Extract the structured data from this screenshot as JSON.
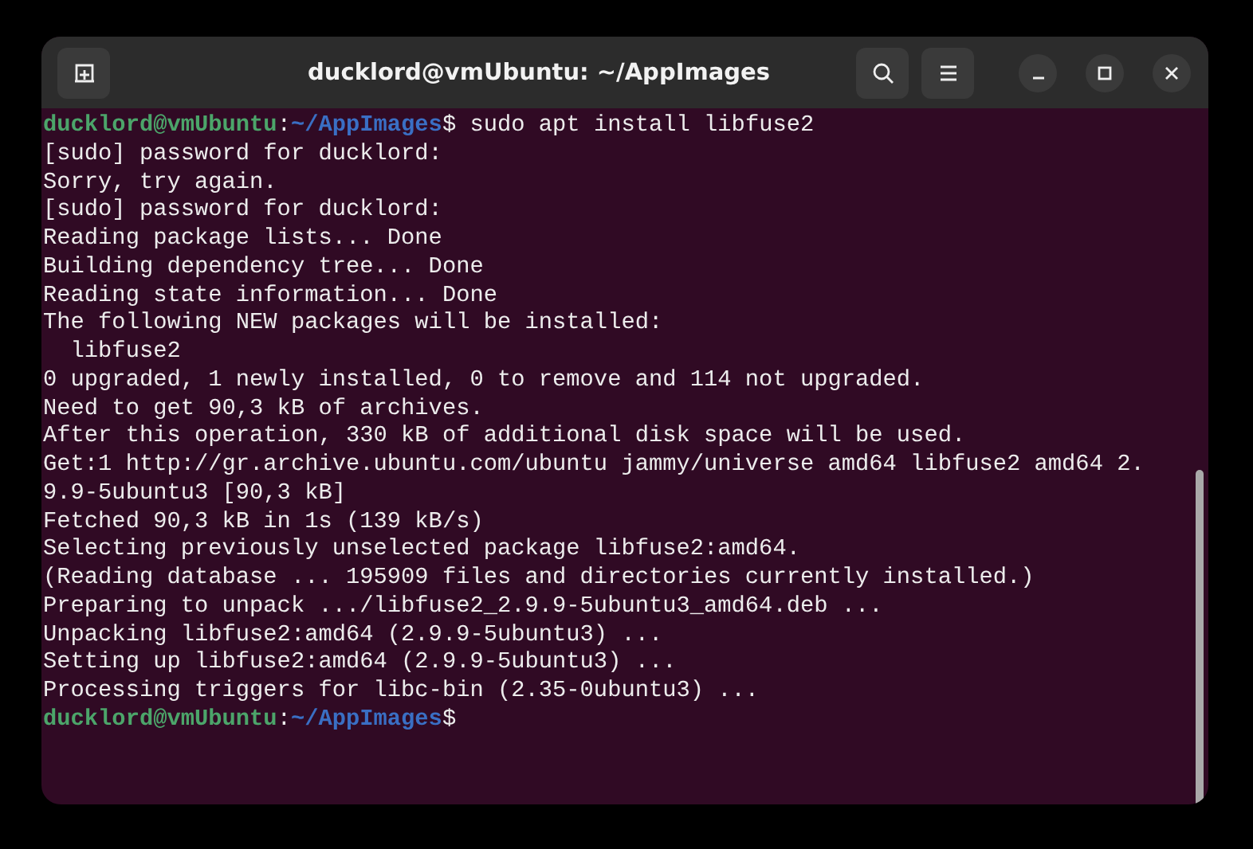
{
  "window": {
    "title": "ducklord@vmUbuntu: ~/AppImages"
  },
  "lines": [
    {
      "kind": "prompt",
      "user": "ducklord@vmUbuntu",
      "separator": ":",
      "path": "~/AppImages",
      "symbol": "$",
      "command": " sudo apt install libfuse2"
    },
    {
      "kind": "output",
      "text": "[sudo] password for ducklord:"
    },
    {
      "kind": "output",
      "text": "Sorry, try again."
    },
    {
      "kind": "output",
      "text": "[sudo] password for ducklord:"
    },
    {
      "kind": "output",
      "text": "Reading package lists... Done"
    },
    {
      "kind": "output",
      "text": "Building dependency tree... Done"
    },
    {
      "kind": "output",
      "text": "Reading state information... Done"
    },
    {
      "kind": "output",
      "text": "The following NEW packages will be installed:"
    },
    {
      "kind": "output",
      "text": "  libfuse2"
    },
    {
      "kind": "output",
      "text": "0 upgraded, 1 newly installed, 0 to remove and 114 not upgraded."
    },
    {
      "kind": "output",
      "text": "Need to get 90,3 kB of archives."
    },
    {
      "kind": "output",
      "text": "After this operation, 330 kB of additional disk space will be used."
    },
    {
      "kind": "output",
      "text": "Get:1 http://gr.archive.ubuntu.com/ubuntu jammy/universe amd64 libfuse2 amd64 2."
    },
    {
      "kind": "output",
      "text": "9.9-5ubuntu3 [90,3 kB]"
    },
    {
      "kind": "output",
      "text": "Fetched 90,3 kB in 1s (139 kB/s)"
    },
    {
      "kind": "output",
      "text": "Selecting previously unselected package libfuse2:amd64."
    },
    {
      "kind": "output",
      "text": "(Reading database ... 195909 files and directories currently installed.)"
    },
    {
      "kind": "output",
      "text": "Preparing to unpack .../libfuse2_2.9.9-5ubuntu3_amd64.deb ..."
    },
    {
      "kind": "output",
      "text": "Unpacking libfuse2:amd64 (2.9.9-5ubuntu3) ..."
    },
    {
      "kind": "output",
      "text": "Setting up libfuse2:amd64 (2.9.9-5ubuntu3) ..."
    },
    {
      "kind": "output",
      "text": "Processing triggers for libc-bin (2.35-0ubuntu3) ..."
    },
    {
      "kind": "prompt",
      "user": "ducklord@vmUbuntu",
      "separator": ":",
      "path": "~/AppImages",
      "symbol": "$"
    }
  ]
}
